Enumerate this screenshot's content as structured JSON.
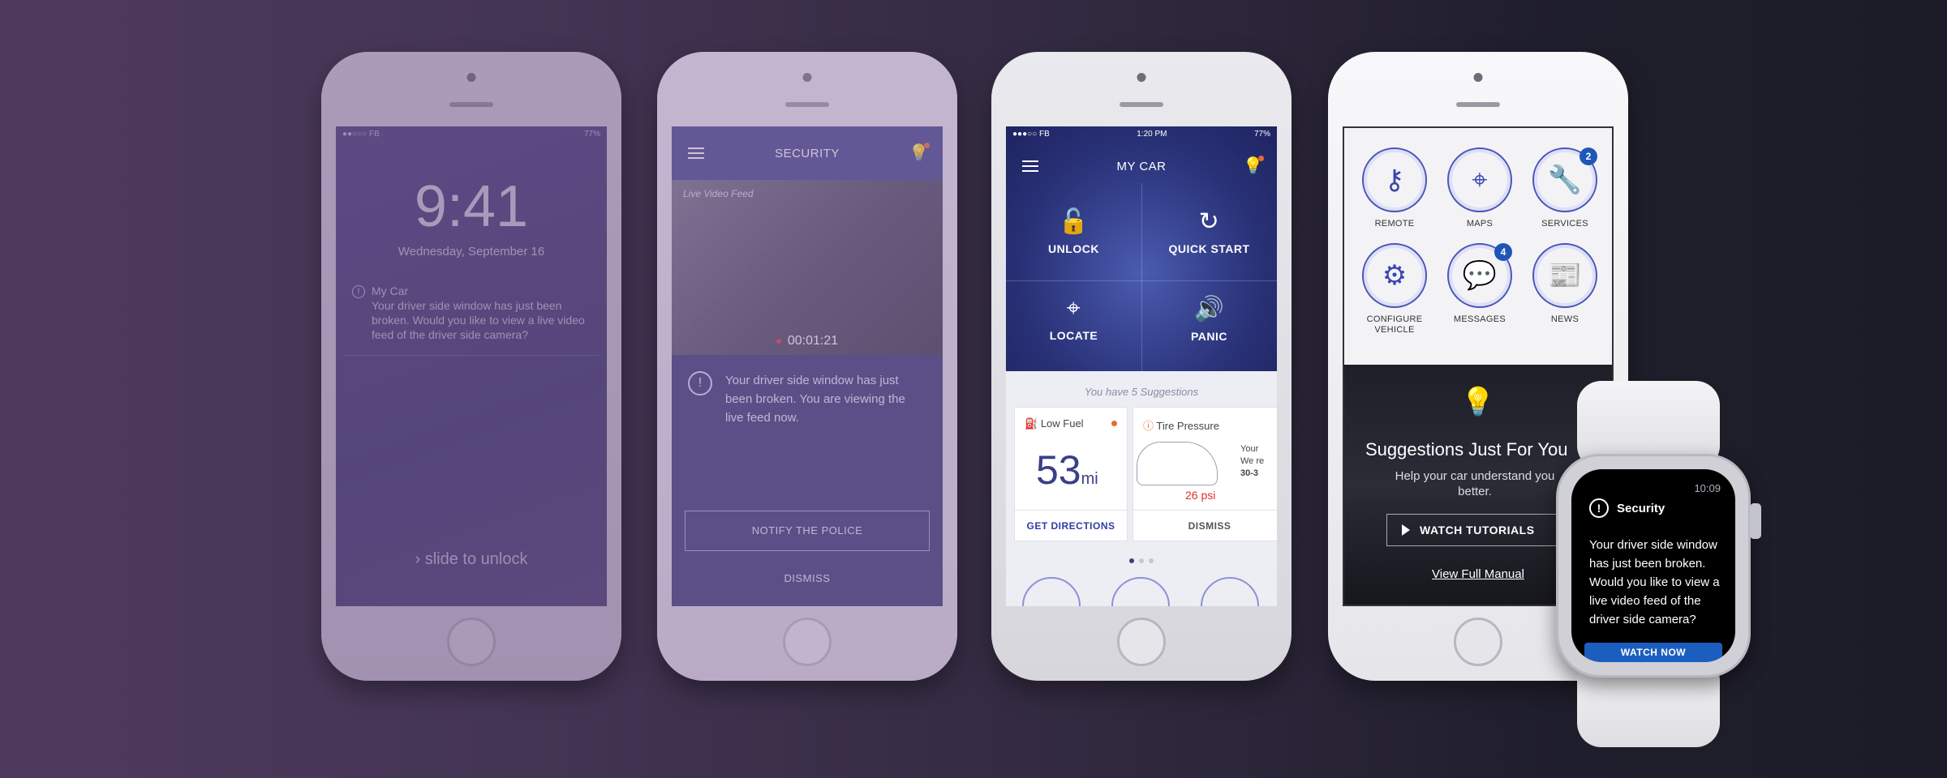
{
  "lock_screen": {
    "status_left": "●●○○○ FB",
    "status_right": "77%",
    "time": "9:41",
    "date": "Wednesday, September 16",
    "notification_title": "My Car",
    "notification_body": "Your driver side window has just been broken.  Would you like to view a live video feed of the driver side camera?",
    "slide_text": "slide to unlock"
  },
  "security": {
    "title": "SECURITY",
    "video_label": "Live Video Feed",
    "video_time": "00:01:21",
    "alert_text": "Your driver side window has just been broken.  You are viewing the live feed now.",
    "notify_label": "NOTIFY THE POLICE",
    "dismiss_label": "DISMISS"
  },
  "my_car": {
    "status_left": "●●●○○ FB",
    "status_time": "1:20 PM",
    "status_right": "77%",
    "title": "MY CAR",
    "actions": [
      {
        "label": "UNLOCK",
        "icon": "🔓"
      },
      {
        "label": "QUICK START",
        "icon": "↻"
      },
      {
        "label": "LOCATE",
        "icon": "⌖"
      },
      {
        "label": "PANIC",
        "icon": "🔊"
      }
    ],
    "suggestions_title": "You have 5 Suggestions",
    "fuel_card": {
      "title": "Low Fuel",
      "value": "53",
      "unit": "mi",
      "action": "GET DIRECTIONS"
    },
    "tire_card": {
      "title": "Tire Pressure",
      "psi": "26 psi",
      "note1": "Your",
      "note2": "We re",
      "note3": "30-3",
      "action": "DISMISS"
    }
  },
  "home": {
    "tiles": [
      {
        "label": "REMOTE",
        "icon": "⚷",
        "badge": ""
      },
      {
        "label": "MAPS",
        "icon": "⌖",
        "badge": ""
      },
      {
        "label": "SERVICES",
        "icon": "🔧",
        "badge": "2"
      },
      {
        "label": "CONFIGURE VEHICLE",
        "icon": "⚙",
        "badge": ""
      },
      {
        "label": "MESSAGES",
        "icon": "💬",
        "badge": "4"
      },
      {
        "label": "NEWS",
        "icon": "📰",
        "badge": ""
      }
    ],
    "suggestions_heading": "Suggestions Just For You",
    "suggestions_sub": "Help your car understand you better.",
    "tutorials_label": "WATCH TUTORIALS",
    "manual_label": "View Full Manual"
  },
  "watch": {
    "time": "10:09",
    "title": "Security",
    "body": "Your driver side window has just been broken. Would you like to view a live video feed of the driver side camera?",
    "button": "WATCH NOW"
  },
  "colors": {
    "accent": "#3a3f86",
    "badge": "#1f57b8",
    "alert_red": "#e03030",
    "orange": "#e56b2f"
  }
}
